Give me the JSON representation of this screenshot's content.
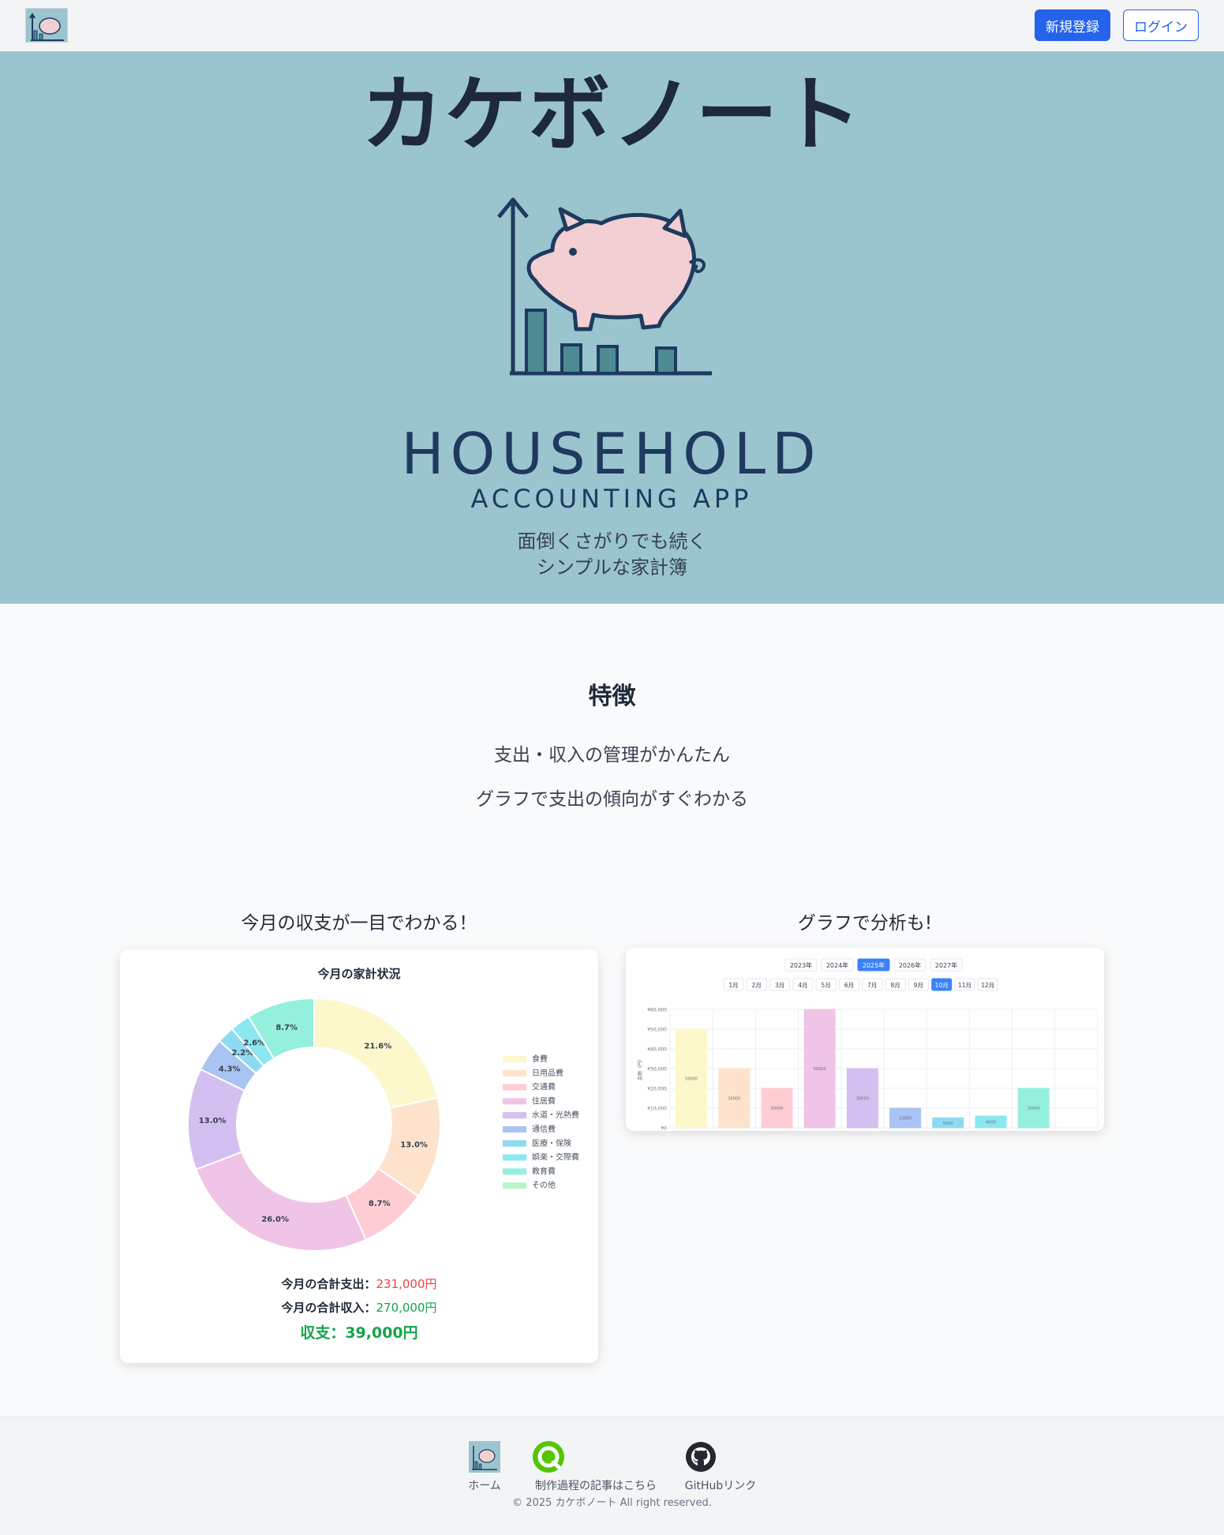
{
  "header": {
    "signup_label": "新規登録",
    "login_label": "ログイン"
  },
  "hero": {
    "title": "カケボノート",
    "logo_line1": "HOUSEHOLD",
    "logo_line2": "ACCOUNTING APP",
    "tagline_line1": "面倒くさがりでも続く",
    "tagline_line2": "シンプルな家計簿"
  },
  "features": {
    "title": "特徴",
    "items": [
      "支出・収入の管理がかんたん",
      "グラフで支出の傾向がすぐわかる"
    ]
  },
  "preview": {
    "left_title": "今月の収支が一目でわかる！",
    "right_title": "グラフで分析も!"
  },
  "summary": {
    "title": "今月の家計状況",
    "expense_label": "今月の合計支出：",
    "expense_value": "231,000円",
    "income_label": "今月の合計収入：",
    "income_value": "270,000円",
    "balance": "収支：39,000円"
  },
  "chart_data": [
    {
      "type": "pie",
      "title": "今月の家計状況",
      "legend_position": "right",
      "categories": [
        "食費",
        "日用品費",
        "交通費",
        "住居費",
        "水道・光熱費",
        "通信費",
        "医療・保険",
        "娯楽・交際費",
        "教育費",
        "その他"
      ],
      "values": [
        21.6,
        13.0,
        8.7,
        26.0,
        13.0,
        4.3,
        2.2,
        2.6,
        8.7,
        0
      ],
      "labels": [
        "21.6%",
        "13.0%",
        "8.7%",
        "26.0%",
        "13.0%",
        "4.3%",
        "2.2%",
        "2.6%",
        "8.7%",
        ""
      ],
      "colors": [
        "#fcf8cc",
        "#fde3cc",
        "#fecdd3",
        "#f0c4e6",
        "#d3bff0",
        "#a9c4f2",
        "#8edaf2",
        "#8ce8ee",
        "#94f0dc",
        "#b9f5c6"
      ]
    },
    {
      "type": "bar",
      "years": [
        "2023年",
        "2024年",
        "2025年",
        "2026年",
        "2027年"
      ],
      "selected_year": "2025年",
      "months": [
        "1月",
        "2月",
        "3月",
        "4月",
        "5月",
        "6月",
        "7月",
        "8月",
        "9月",
        "10月",
        "11月",
        "12月"
      ],
      "selected_month": "10月",
      "ylabel": "金額（円）",
      "y_ticks": [
        "¥0",
        "¥10,000",
        "¥20,000",
        "¥30,000",
        "¥40,000",
        "¥50,000",
        "¥60,000"
      ],
      "ylim": [
        0,
        60000
      ],
      "grid": true,
      "categories": [
        "食費",
        "日用品費",
        "交通費",
        "住居費",
        "水道・光熱費",
        "通信費",
        "医療・保険",
        "娯楽・交際費",
        "教育費",
        "その他"
      ],
      "values": [
        50000,
        30000,
        20000,
        60000,
        30000,
        10000,
        5000,
        6000,
        20000,
        0
      ],
      "value_labels": [
        "50000",
        "30000",
        "20000",
        "60000",
        "30000",
        "10000",
        "5000",
        "6000",
        "20000",
        ""
      ],
      "colors": [
        "#fcf8cc",
        "#fde3cc",
        "#fecdd3",
        "#f0c4e6",
        "#d3bff0",
        "#a9c4f2",
        "#8edaf2",
        "#8ce8ee",
        "#94f0dc",
        "#b9f5c6"
      ],
      "icons": [
        "fork-knife-icon",
        "spray-bottle-icon",
        "bus-icon",
        "home-icon",
        "bulb-icon",
        "phone-icon",
        "hospital-icon",
        "music-icon",
        "graduation-icon",
        "box-icon"
      ]
    }
  ],
  "footer": {
    "home_label": "ホーム",
    "article_label": "制作過程の記事はこちら",
    "github_label": "GitHubリンク",
    "copyright": "© 2025 カケボノート All right reserved."
  }
}
